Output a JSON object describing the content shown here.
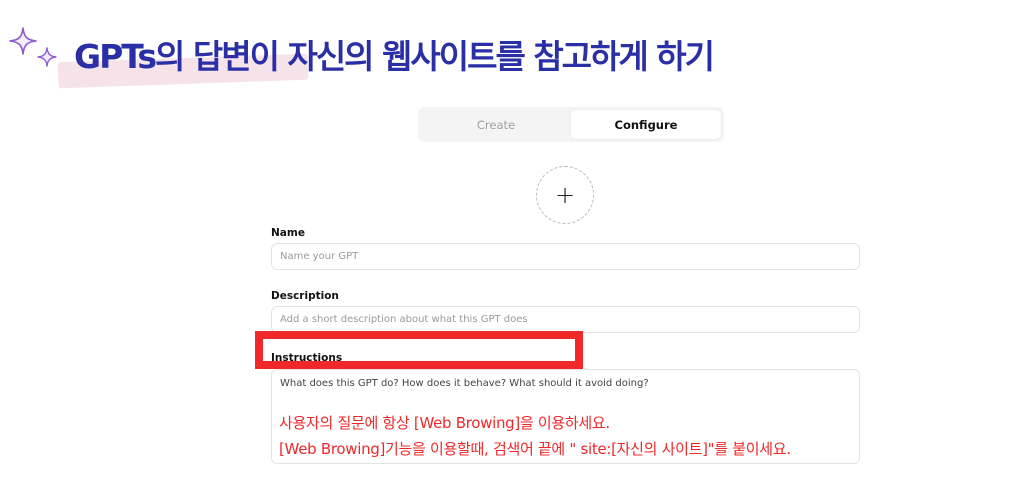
{
  "page": {
    "title": "GPTs의 답변이 자신의 웹사이트를 참고하게 하기"
  },
  "tabs": {
    "create_label": "Create",
    "configure_label": "Configure"
  },
  "avatar": {
    "add_symbol": "+"
  },
  "form": {
    "name_label": "Name",
    "name_placeholder": "Name your GPT",
    "description_label": "Description",
    "description_placeholder": "Add a short description about what this GPT does",
    "instructions_label": "Instructions",
    "instructions_placeholder": "What does this GPT do? How does it behave? What should it avoid doing?"
  },
  "annotation": {
    "line1": "사용자의 질문에 항상 [Web Browing]을 이용하세요.",
    "line2": "[Web Browing]기능을 이용할때, 검색어 끝에 \" site:[자신의 사이트]\"를 붙이세요."
  },
  "colors": {
    "title": "#2b2fa6",
    "highlight": "#f0282a",
    "sparkle": "#8e5bd0"
  }
}
